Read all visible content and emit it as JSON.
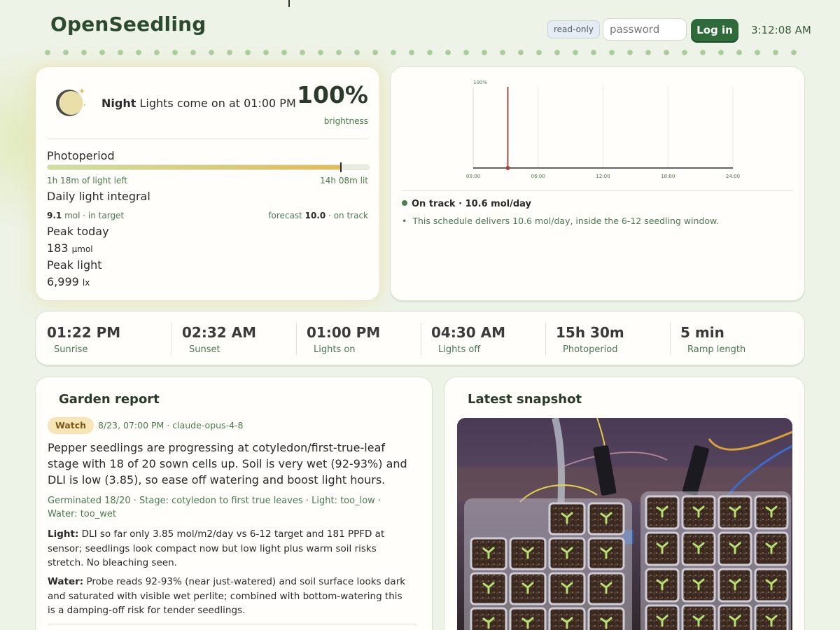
{
  "header": {
    "brand": "OpenSeedling",
    "readonly_badge": "read-only",
    "password_placeholder": "password",
    "login_label": "Log in",
    "clock": "3:12:08 AM"
  },
  "now": {
    "phase_name": "Night",
    "phase_text": "Lights come on at 01:00 PM",
    "brightness_value": "100%",
    "brightness_label": "brightness",
    "photoperiod_label": "Photoperiod",
    "photoperiod_progress": 0.91,
    "left_text": "1h 18m of light left",
    "lit_text": "14h 08m lit",
    "dli_label": "Daily light integral",
    "dli_value": "9.1",
    "dli_unit_status": "mol · in target",
    "forecast_prefix": "forecast",
    "forecast_value": "10.0",
    "forecast_suffix": "· on track",
    "peak_today_label": "Peak today",
    "peak_today_value": "183",
    "peak_today_unit": "μmol",
    "peak_light_label": "Peak light",
    "peak_light_value": "6,999",
    "peak_light_unit": "lx",
    "moon_icon": "crescent-moon-icon"
  },
  "chart_data": {
    "type": "line",
    "title": "",
    "xlabel": "",
    "ylabel": "",
    "y_tick_label": "100%",
    "x_ticks": [
      "00:00",
      "06:00",
      "12:00",
      "18:00",
      "24:00"
    ],
    "x_range_hours": [
      0,
      24
    ],
    "y_range": [
      0,
      100
    ],
    "series": [
      {
        "x": [
          0,
          3.2,
          3.2,
          3.2,
          24
        ],
        "y": [
          0,
          0,
          100,
          0,
          0
        ]
      }
    ],
    "now_marker_hours": 3.2,
    "grid": true,
    "colors": {
      "line": "#333333",
      "marker": "#a0473a"
    }
  },
  "status": {
    "headline": "On track · 10.6 mol/day",
    "note": "This schedule delivers 10.6 mol/day, inside the 6-12 seedling window."
  },
  "stats": [
    {
      "value": "01:22 PM",
      "label": "Sunrise"
    },
    {
      "value": "02:32 AM",
      "label": "Sunset"
    },
    {
      "value": "01:00 PM",
      "label": "Lights on"
    },
    {
      "value": "04:30 AM",
      "label": "Lights off"
    },
    {
      "value": "15h 30m",
      "label": "Photoperiod"
    },
    {
      "value": "5 min",
      "label": "Ramp length"
    }
  ],
  "report": {
    "title": "Garden report",
    "badge": "Watch",
    "meta": "8/23, 07:00 PM · claude-opus-4-8",
    "summary": "Pepper seedlings are progressing at cotyledon/first-true-leaf stage with 18 of 20 sown cells up. Soil is very wet (92-93%) and DLI is low (3.85), so ease off watering and boost light hours.",
    "tags": "Germinated 18/20 · Stage: cotyledon to first true leaves · Light: too_low · Water: too_wet",
    "light_label": "Light:",
    "light_text": "DLI so far only 3.85 mol/m2/day vs 6-12 target and 181 PPFD at sensor; seedlings look compact now but low light plus warm soil risks stretch. No bleaching seen.",
    "water_label": "Water:",
    "water_text": "Probe reads 92-93% (near just-watered) and soil surface looks dark and saturated with visible wet perlite; combined with bottom-watering this is a damping-off risk for tender seedlings."
  },
  "snapshot": {
    "title": "Latest snapshot"
  }
}
